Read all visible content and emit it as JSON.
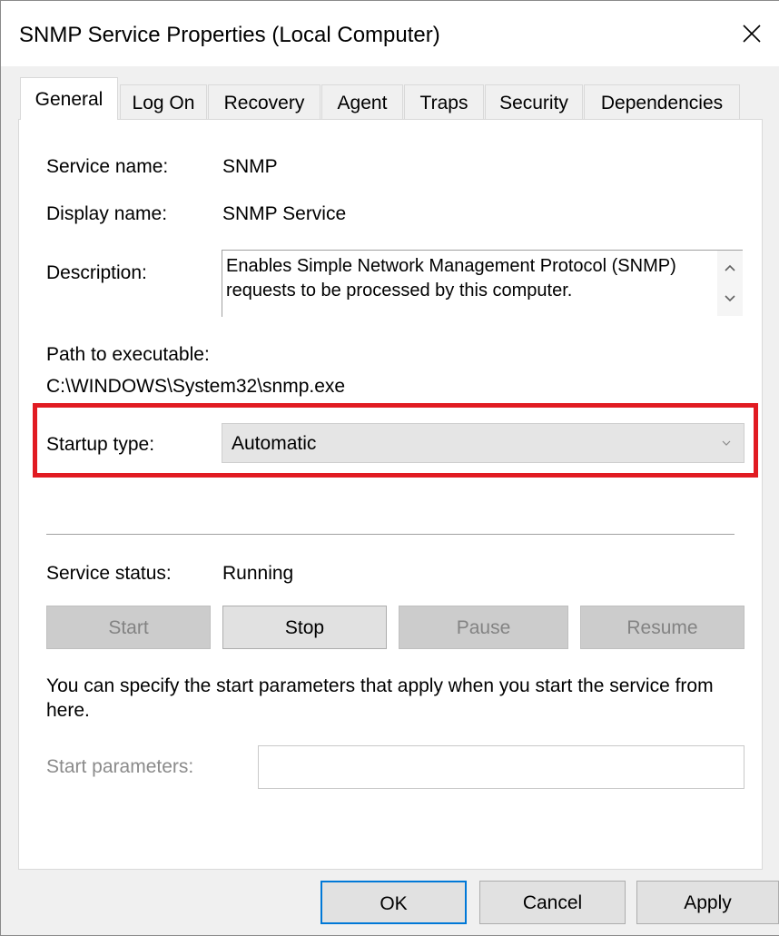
{
  "window": {
    "title": "SNMP Service Properties (Local Computer)",
    "close_icon": "close-icon"
  },
  "tabs": [
    {
      "label": "General",
      "active": true
    },
    {
      "label": "Log On",
      "active": false
    },
    {
      "label": "Recovery",
      "active": false
    },
    {
      "label": "Agent",
      "active": false
    },
    {
      "label": "Traps",
      "active": false
    },
    {
      "label": "Security",
      "active": false
    },
    {
      "label": "Dependencies",
      "active": false
    }
  ],
  "general": {
    "service_name_label": "Service name:",
    "service_name": "SNMP",
    "display_name_label": "Display name:",
    "display_name": "SNMP Service",
    "description_label": "Description:",
    "description": "Enables Simple Network Management Protocol (SNMP) requests to be processed by this computer.",
    "path_label": "Path to executable:",
    "path": "C:\\WINDOWS\\System32\\snmp.exe",
    "startup_type_label": "Startup type:",
    "startup_type": "Automatic",
    "service_status_label": "Service status:",
    "service_status": "Running",
    "buttons": {
      "start": "Start",
      "stop": "Stop",
      "pause": "Pause",
      "resume": "Resume"
    },
    "help_text": "You can specify the start parameters that apply when you start the service from here.",
    "start_params_label": "Start parameters:",
    "start_params_value": ""
  },
  "dialog_buttons": {
    "ok": "OK",
    "cancel": "Cancel",
    "apply": "Apply"
  },
  "colors": {
    "highlight": "#e11b22",
    "focus": "#0078d7"
  }
}
